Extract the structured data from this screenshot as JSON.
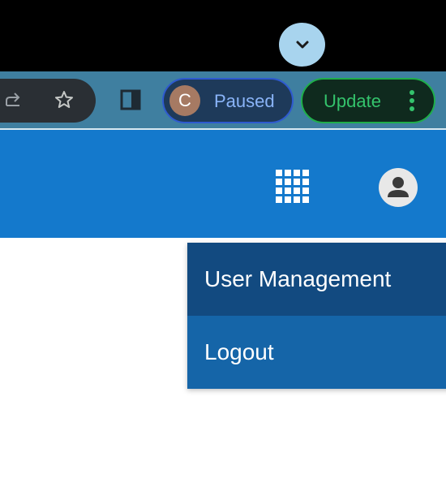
{
  "browser": {
    "tab_search": {
      "icon": "chevron-down-icon"
    },
    "toolbar": {
      "share_icon": "share-icon",
      "bookmark_icon": "star-icon",
      "side_panel_icon": "side-panel-icon",
      "profile": {
        "avatar_letter": "C",
        "label": "Paused"
      },
      "update": {
        "label": "Update",
        "menu_icon": "more-vert-icon"
      }
    }
  },
  "app_header": {
    "apps_icon": "apps-grid-icon",
    "account_icon": "account-circle-icon"
  },
  "user_menu": {
    "items": [
      {
        "label": "User Management"
      },
      {
        "label": "Logout"
      }
    ]
  },
  "colors": {
    "header_blue": "#1479cc",
    "menu_blue": "#1565a8",
    "menu_active": "#124a80",
    "toolbar": "#3f7fa0",
    "paused_text": "#8ab4f8",
    "update_green": "#34c36c"
  }
}
